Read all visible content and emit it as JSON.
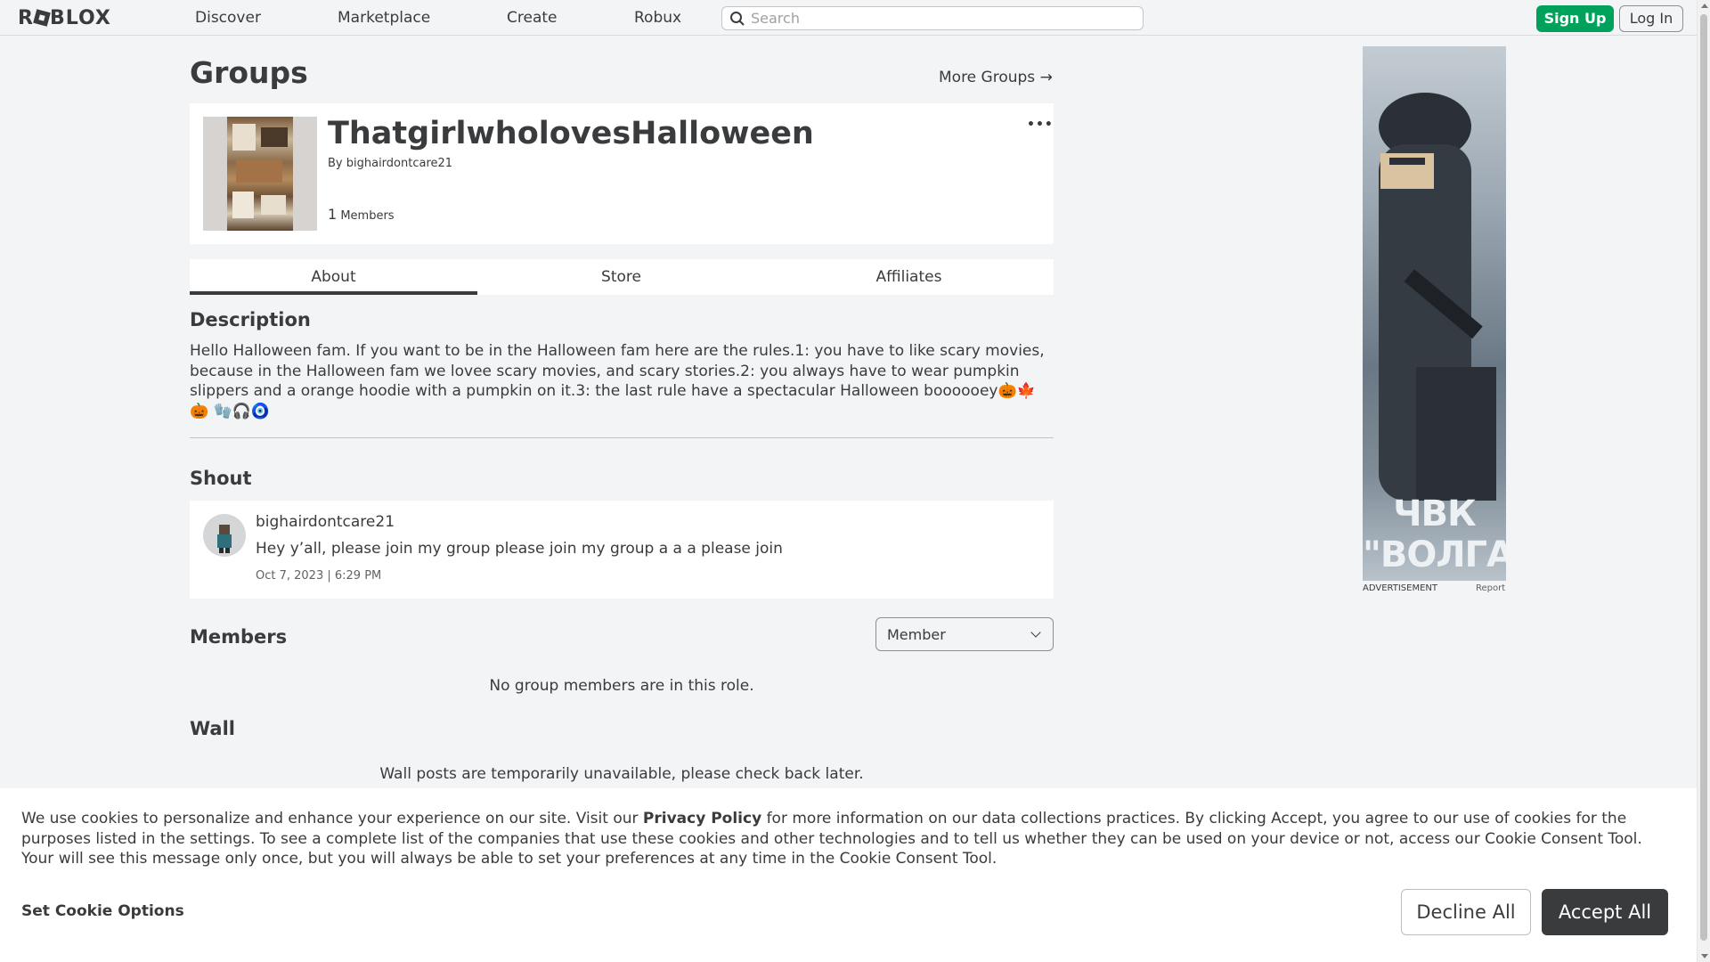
{
  "topnav": {
    "logo": "ROBLOX",
    "links": [
      "Discover",
      "Marketplace",
      "Create",
      "Robux"
    ],
    "search_placeholder": "Search",
    "signup": "Sign Up",
    "login": "Log In"
  },
  "page": {
    "title": "Groups",
    "more_groups": "More Groups →"
  },
  "group": {
    "name": "ThatgirlwholovesHalloween",
    "by_prefix": "By ",
    "owner": "bighairdontcare21",
    "member_count": "1",
    "members_label": " Members",
    "menu": "•••"
  },
  "tabs": [
    "About",
    "Store",
    "Affiliates"
  ],
  "about": {
    "description_heading": "Description",
    "description": "Hello Halloween fam. If you want to be in the Halloween fam here are the rules.1: you have to like scary movies, because in the Halloween fam we lovee scary movies, and scary stories.2: you always have to wear pumpkin slippers and a orange hoodie with a pumpkin on it.3: the last rule have a spectacular Halloween boooooey🎃🍁🎃 🧤🎧🧿",
    "shout_heading": "Shout",
    "shout": {
      "user": "bighairdontcare21",
      "text": "Hey y’all, please join my group please join my group a a a please join",
      "date": "Oct 7, 2023 | 6:29 PM"
    },
    "members_heading": "Members",
    "role_selected": "Member",
    "members_empty": "No group members are in this role.",
    "wall_heading": "Wall",
    "wall_empty": "Wall posts are temporarily unavailable, please check back later."
  },
  "ad": {
    "label": "ADVERTISEMENT",
    "report": "Report",
    "text": "ЧВК \"ВОЛГА\""
  },
  "cookie": {
    "text_before": "We use cookies to personalize and enhance your experience on our site. Visit our ",
    "policy_link": "Privacy Policy",
    "text_after": " for more information on our data collections practices. By clicking Accept, you agree to our use of cookies for the purposes listed in the settings. To see a complete list of the companies that use these cookies and other technologies and to tell us whether they can be used on your device or not, access our Cookie Consent Tool. Your will see this message only once, but you will always be able to set your preferences at any time in the Cookie Consent Tool.",
    "options": "Set Cookie Options",
    "decline": "Decline All",
    "accept": "Accept All"
  },
  "colors": {
    "background": "#f2f4f5",
    "signup_green": "#00a25b",
    "text": "#393b3d",
    "accept_dark": "#393b3d"
  }
}
